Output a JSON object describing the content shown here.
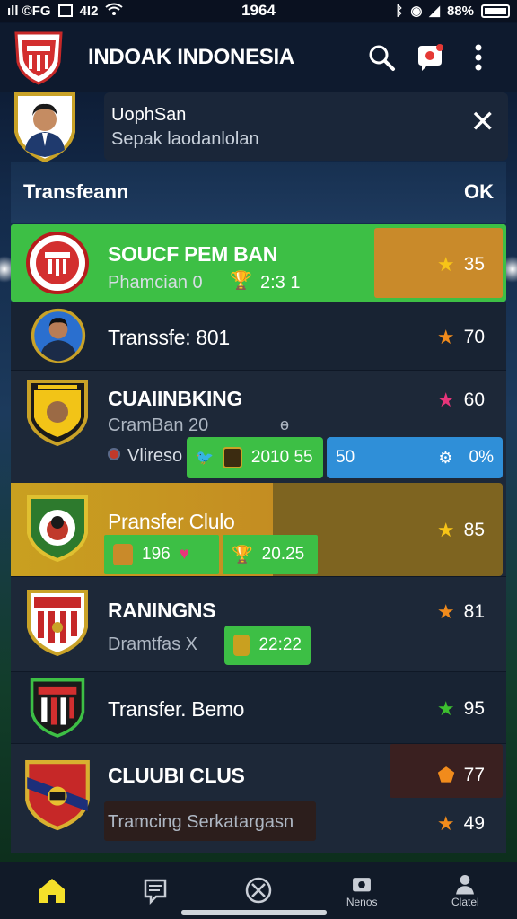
{
  "status_bar": {
    "left": "ıll ©FG",
    "left_value": "4I2",
    "time": "1964",
    "battery": "88%"
  },
  "app_bar": {
    "title": "INDOAK INDONESIA"
  },
  "profile": {
    "name": "UophSan",
    "subtitle": "Sepak laodanlolan"
  },
  "list_header": {
    "title": "Transfeann",
    "action": "OK"
  },
  "rows": [
    {
      "title": "SOUCF PEM BAN",
      "subtitle": "Phamcian  0",
      "pill": "2:3  1",
      "score": "35"
    },
    {
      "title": "Transsfe: 801",
      "score": "70"
    },
    {
      "title": "CUAIINBKING",
      "subtitle": "CramBan  20",
      "label": "Vlireso",
      "pill": "2010 55",
      "pill_blue_left": "50",
      "pill_blue_right": "0%",
      "score": "60"
    },
    {
      "title": "Pransfer Clulo",
      "pill1": "196",
      "pill2": "20.25",
      "score": "85"
    },
    {
      "title": "RANINGNS",
      "subtitle": "Dramtfas  X",
      "pill": "22:22",
      "score": "81"
    },
    {
      "title": "Transfer. Bemo",
      "score": "95"
    },
    {
      "title": "CLUUBI CLUS",
      "subtitle": "Tramcing Serkatargasn",
      "score1": "77",
      "score2": "49"
    }
  ],
  "colors": {
    "green": "#3dbf45",
    "orange": "#c98a2a",
    "gold": "#c9a020",
    "blue": "#2f8fd8",
    "star_yellow": "#f7c417",
    "star_orange": "#f18b1c",
    "star_pink": "#e8357a",
    "star_green": "#3dbf2f"
  },
  "bottom_nav": [
    {
      "icon": "home-icon",
      "label": ""
    },
    {
      "icon": "news-icon",
      "label": ""
    },
    {
      "icon": "ball-icon",
      "label": ""
    },
    {
      "icon": "camera-icon",
      "label": "Nenos"
    },
    {
      "icon": "person-icon",
      "label": "Clatel"
    }
  ]
}
